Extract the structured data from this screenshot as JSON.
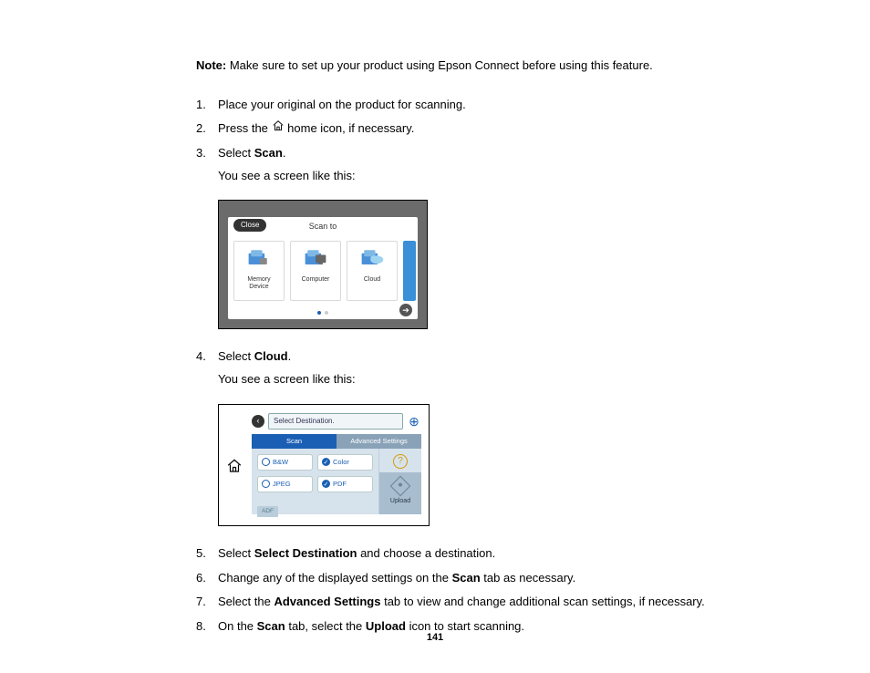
{
  "note_label": "Note:",
  "note_text": "Make sure to set up your product using Epson Connect before using this feature.",
  "steps": {
    "s1": {
      "num": "1.",
      "text": "Place your original on the product for scanning."
    },
    "s2": {
      "num": "2.",
      "pre": "Press the ",
      "post": " home icon, if necessary."
    },
    "s3": {
      "num": "3.",
      "pre": "Select ",
      "bold": "Scan",
      "post": ".",
      "sub": "You see a screen like this:"
    },
    "s4": {
      "num": "4.",
      "pre": "Select ",
      "bold": "Cloud",
      "post": ".",
      "sub": "You see a screen like this:"
    },
    "s5": {
      "num": "5.",
      "pre": "Select ",
      "bold": "Select Destination",
      "post": " and choose a destination."
    },
    "s6": {
      "num": "6.",
      "pre": "Change any of the displayed settings on the ",
      "bold": "Scan",
      "post": " tab as necessary."
    },
    "s7": {
      "num": "7.",
      "pre": "Select the ",
      "bold": "Advanced Settings",
      "post": " tab to view and change additional scan settings, if necessary."
    },
    "s8": {
      "num": "8.",
      "pre": "On the ",
      "bold": "Scan",
      "mid": " tab, select the ",
      "bold2": "Upload",
      "post": " icon to start scanning."
    }
  },
  "fig1": {
    "title": "Scan to",
    "close": "Close",
    "tiles": {
      "memory": "Memory\nDevice",
      "computer": "Computer",
      "cloud": "Cloud"
    }
  },
  "fig2": {
    "dest": "Select Destination.",
    "tabs": {
      "scan": "Scan",
      "adv": "Advanced Settings"
    },
    "opts": {
      "bw": "B&W",
      "color": "Color",
      "jpeg": "JPEG",
      "pdf": "PDF"
    },
    "adf": "ADF",
    "upload": "Upload"
  },
  "page_number": "141"
}
